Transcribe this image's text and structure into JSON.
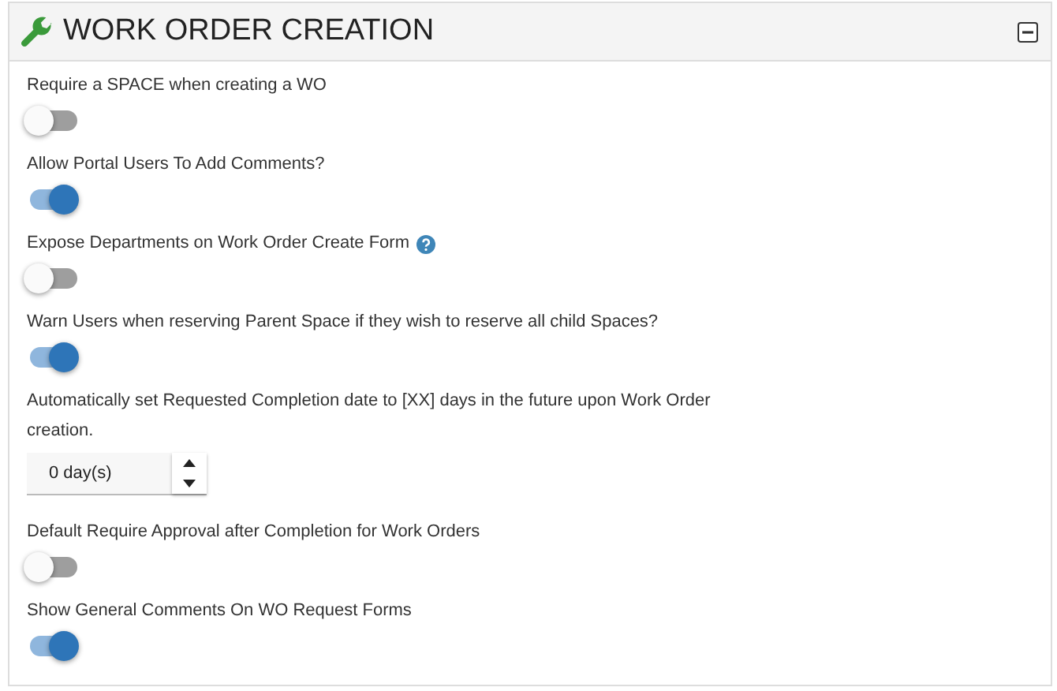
{
  "panel": {
    "title": "WORK ORDER CREATION",
    "expanded": true
  },
  "settings": [
    {
      "kind": "toggle",
      "label": "Require a SPACE when creating a WO",
      "on": false
    },
    {
      "kind": "toggle",
      "label": "Allow Portal Users To Add Comments?",
      "on": true
    },
    {
      "kind": "toggle",
      "label": "Expose Departments on Work Order Create Form",
      "on": false,
      "help": true
    },
    {
      "kind": "toggle",
      "label": "Warn Users when reserving Parent Space if they wish to reserve all child Spaces?",
      "on": true
    },
    {
      "kind": "number",
      "label": "Automatically set Requested Completion date to [XX] days in the future upon Work Order creation.",
      "value": "0 day(s)"
    },
    {
      "kind": "toggle",
      "label": "Default Require Approval after Completion for Work Orders",
      "on": false
    },
    {
      "kind": "toggle",
      "label": "Show General Comments On WO Request Forms",
      "on": true
    }
  ]
}
